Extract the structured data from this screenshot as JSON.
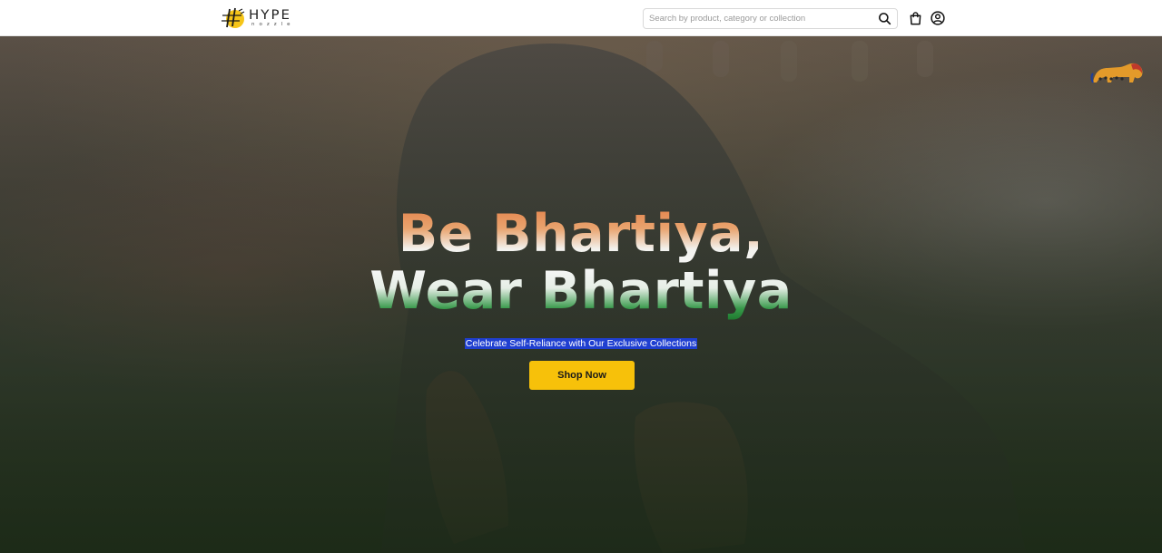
{
  "header": {
    "logo_word": "HYPE",
    "logo_sub": "nozzle",
    "search_placeholder": "Search by product, category or collection",
    "icons": [
      "search-icon",
      "bag-icon",
      "user-icon"
    ]
  },
  "hero": {
    "headline_line1": "Be Bhartiya,",
    "headline_line2": "Wear Bhartiya",
    "subtitle": "Celebrate Self-Reliance with Our Exclusive Collections",
    "cta_label": "Shop Now",
    "badge": "make-in-india-lion-icon"
  },
  "colors": {
    "accent": "#f7c10a",
    "saffron": "#e4824a",
    "green": "#1e7a2f",
    "selection": "#1f3fd0"
  }
}
